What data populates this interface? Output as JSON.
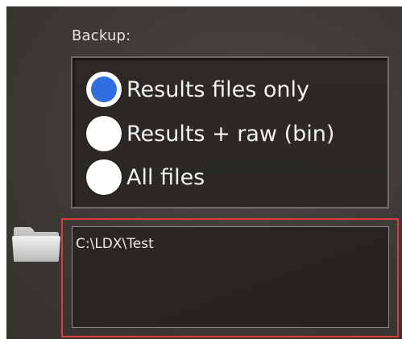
{
  "backup": {
    "label": "Backup:",
    "options": [
      {
        "label": "Results files only",
        "selected": true
      },
      {
        "label": "Results + raw (bin)",
        "selected": false
      },
      {
        "label": "All files",
        "selected": false
      }
    ]
  },
  "path": {
    "value": "C:\\LDX\\Test",
    "icon": "folder-icon"
  },
  "colors": {
    "selected_radio": "#2f6fe0",
    "highlight_border": "#e03a3a"
  }
}
